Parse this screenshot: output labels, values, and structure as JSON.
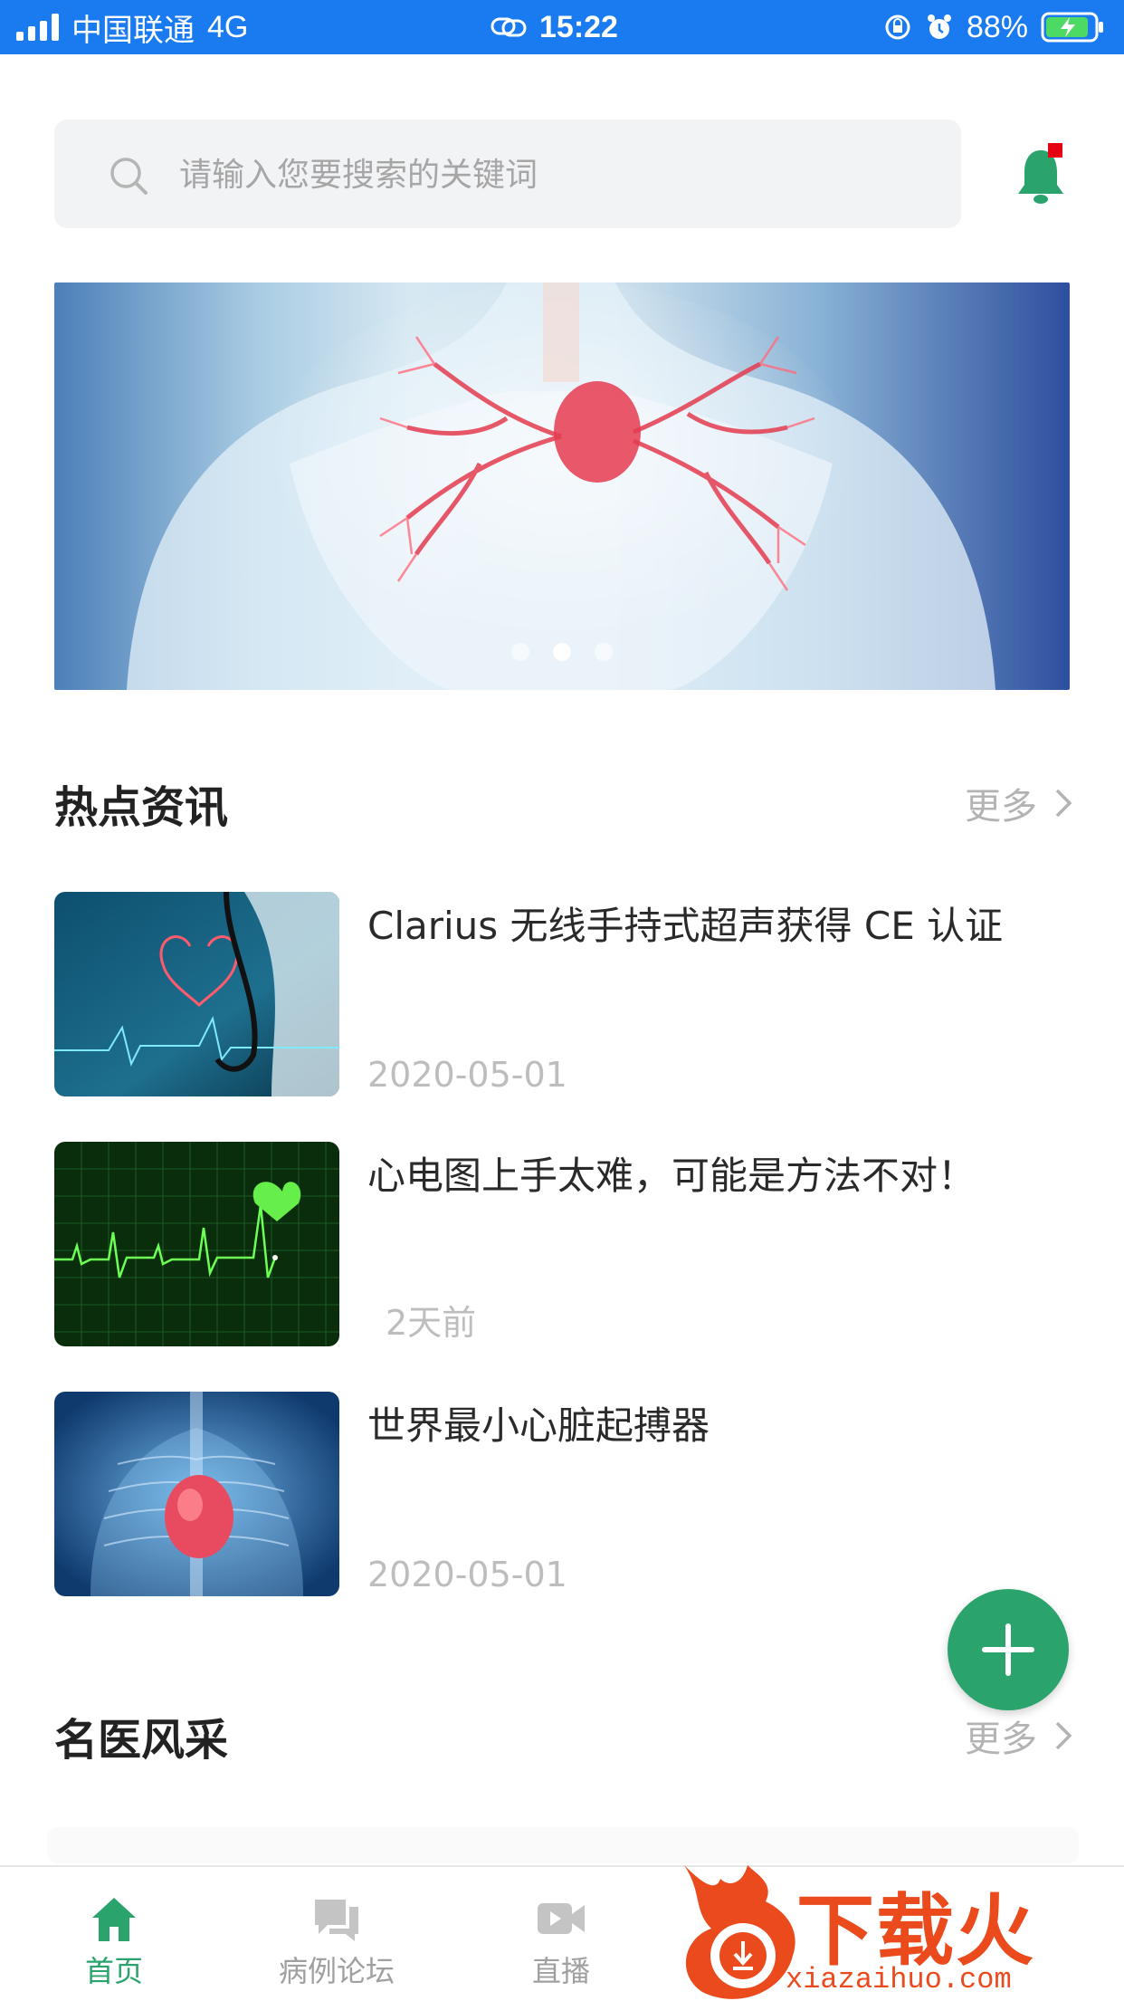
{
  "status_bar": {
    "carrier": "中国联通",
    "network": "4G",
    "time": "15:22",
    "battery": "88%"
  },
  "search": {
    "placeholder": "请输入您要搜索的关键词"
  },
  "banner": {
    "slides": 3,
    "active_index": 1
  },
  "hot_news": {
    "title": "热点资讯",
    "more_label": "更多",
    "items": [
      {
        "title": "Clarius 无线手持式超声获得 CE 认证",
        "date": "2020-05-01",
        "thumb": "stethoscope-heart-image"
      },
      {
        "title": "心电图上手太难，可能是方法不对！",
        "date": "2天前",
        "thumb": "ecg-monitor-image"
      },
      {
        "title": "世界最小心脏起搏器",
        "date": "2020-05-01",
        "thumb": "heart-xray-image"
      }
    ]
  },
  "doctors": {
    "title": "名医风采",
    "more_label": "更多"
  },
  "tabbar": {
    "items": [
      {
        "label": "首页",
        "icon": "home-icon",
        "active": true
      },
      {
        "label": "病例论坛",
        "icon": "forum-icon",
        "active": false
      },
      {
        "label": "直播",
        "icon": "video-icon",
        "active": false
      }
    ]
  },
  "watermark": {
    "text": "下载火",
    "url": "xiazaihuo.com"
  },
  "colors": {
    "status_bar": "#1a7af0",
    "accent_green": "#2ba36d",
    "watermark_orange": "#ea4a1c"
  }
}
